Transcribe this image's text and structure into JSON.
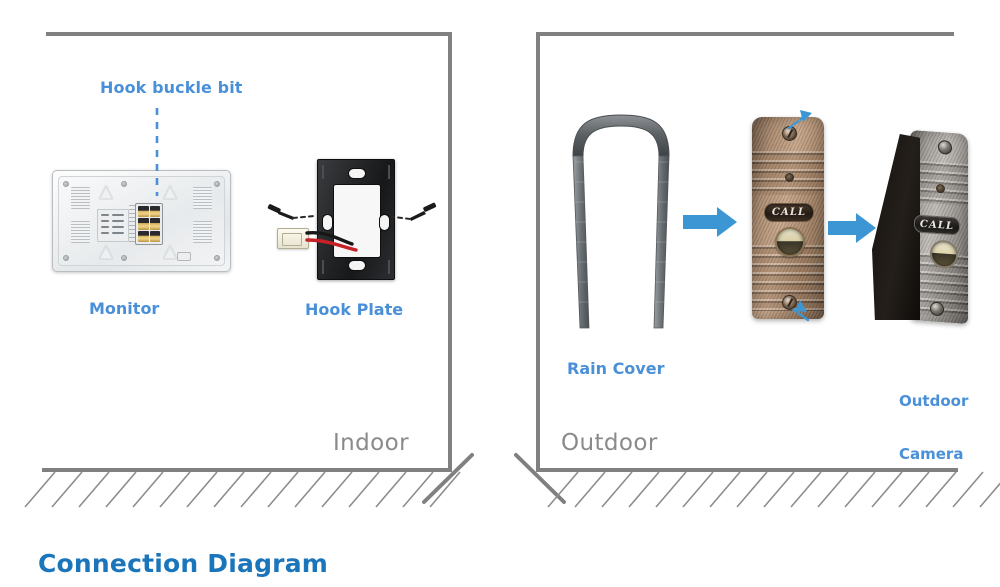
{
  "title": "Connection Diagram",
  "zones": {
    "indoor": "Indoor",
    "outdoor": "Outdoor"
  },
  "labels": {
    "hook_buckle_bit": "Hook buckle bit",
    "monitor": "Monitor",
    "hook_plate": "Hook Plate",
    "rain_cover": "Rain Cover",
    "outdoor_camera_line1": "Outdoor",
    "outdoor_camera_line2": "Camera"
  },
  "components": {
    "call_button_text": "CALL",
    "call_button_text_2": "CALL"
  },
  "colors": {
    "label_blue": "#4a90d9",
    "title_blue": "#1b75bb",
    "zone_gray": "#8a8a8a",
    "wall_gray": "#808080",
    "arrow_blue": "#3d96d4",
    "plate_black": "#232527",
    "camera_bronze": "#a8876b",
    "camera_silver": "#9a9691"
  },
  "arrows": {
    "rain_to_cam": "arrow-right",
    "cam_to_assembled": "arrow-right"
  }
}
